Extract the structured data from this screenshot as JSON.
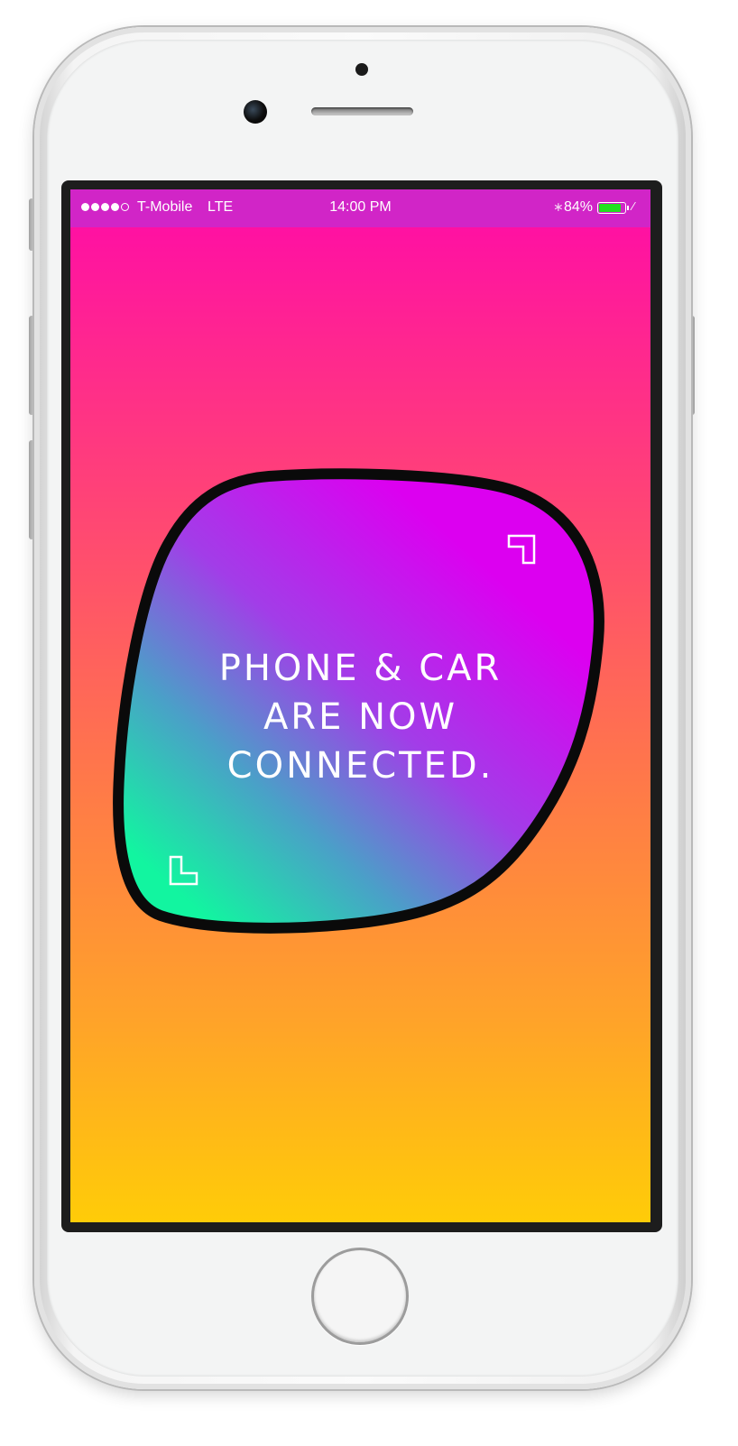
{
  "status_bar": {
    "carrier": "T-Mobile",
    "network": "LTE",
    "time": "14:00 PM",
    "battery_percent_label": "84%",
    "battery_level": 0.84,
    "signal_strength": 4,
    "signal_max": 5,
    "bluetooth_icon": "bluetooth-icon",
    "charging_icon": "charging-icon",
    "background_color": "#d125c7",
    "battery_color": "#22e01f"
  },
  "screen": {
    "gradient_colors": [
      "#ff0aa8",
      "#ff3f7a",
      "#ff7a48",
      "#ffa22a",
      "#ffcc08"
    ],
    "message": {
      "line1": "PHONE & CAR",
      "line2": "ARE NOW",
      "line3": "CONNECTED."
    },
    "blob_gradient_colors": [
      "#d400ff",
      "#9a3fe6",
      "#4aa0c8",
      "#12f5a0"
    ],
    "corner_icons": [
      "corner-bracket-top-right-icon",
      "corner-bracket-bottom-left-icon"
    ]
  },
  "device": {
    "home_button_icon": "home-button",
    "camera_icon": "front-camera-icon",
    "speaker_icon": "earpiece-speaker-icon"
  }
}
